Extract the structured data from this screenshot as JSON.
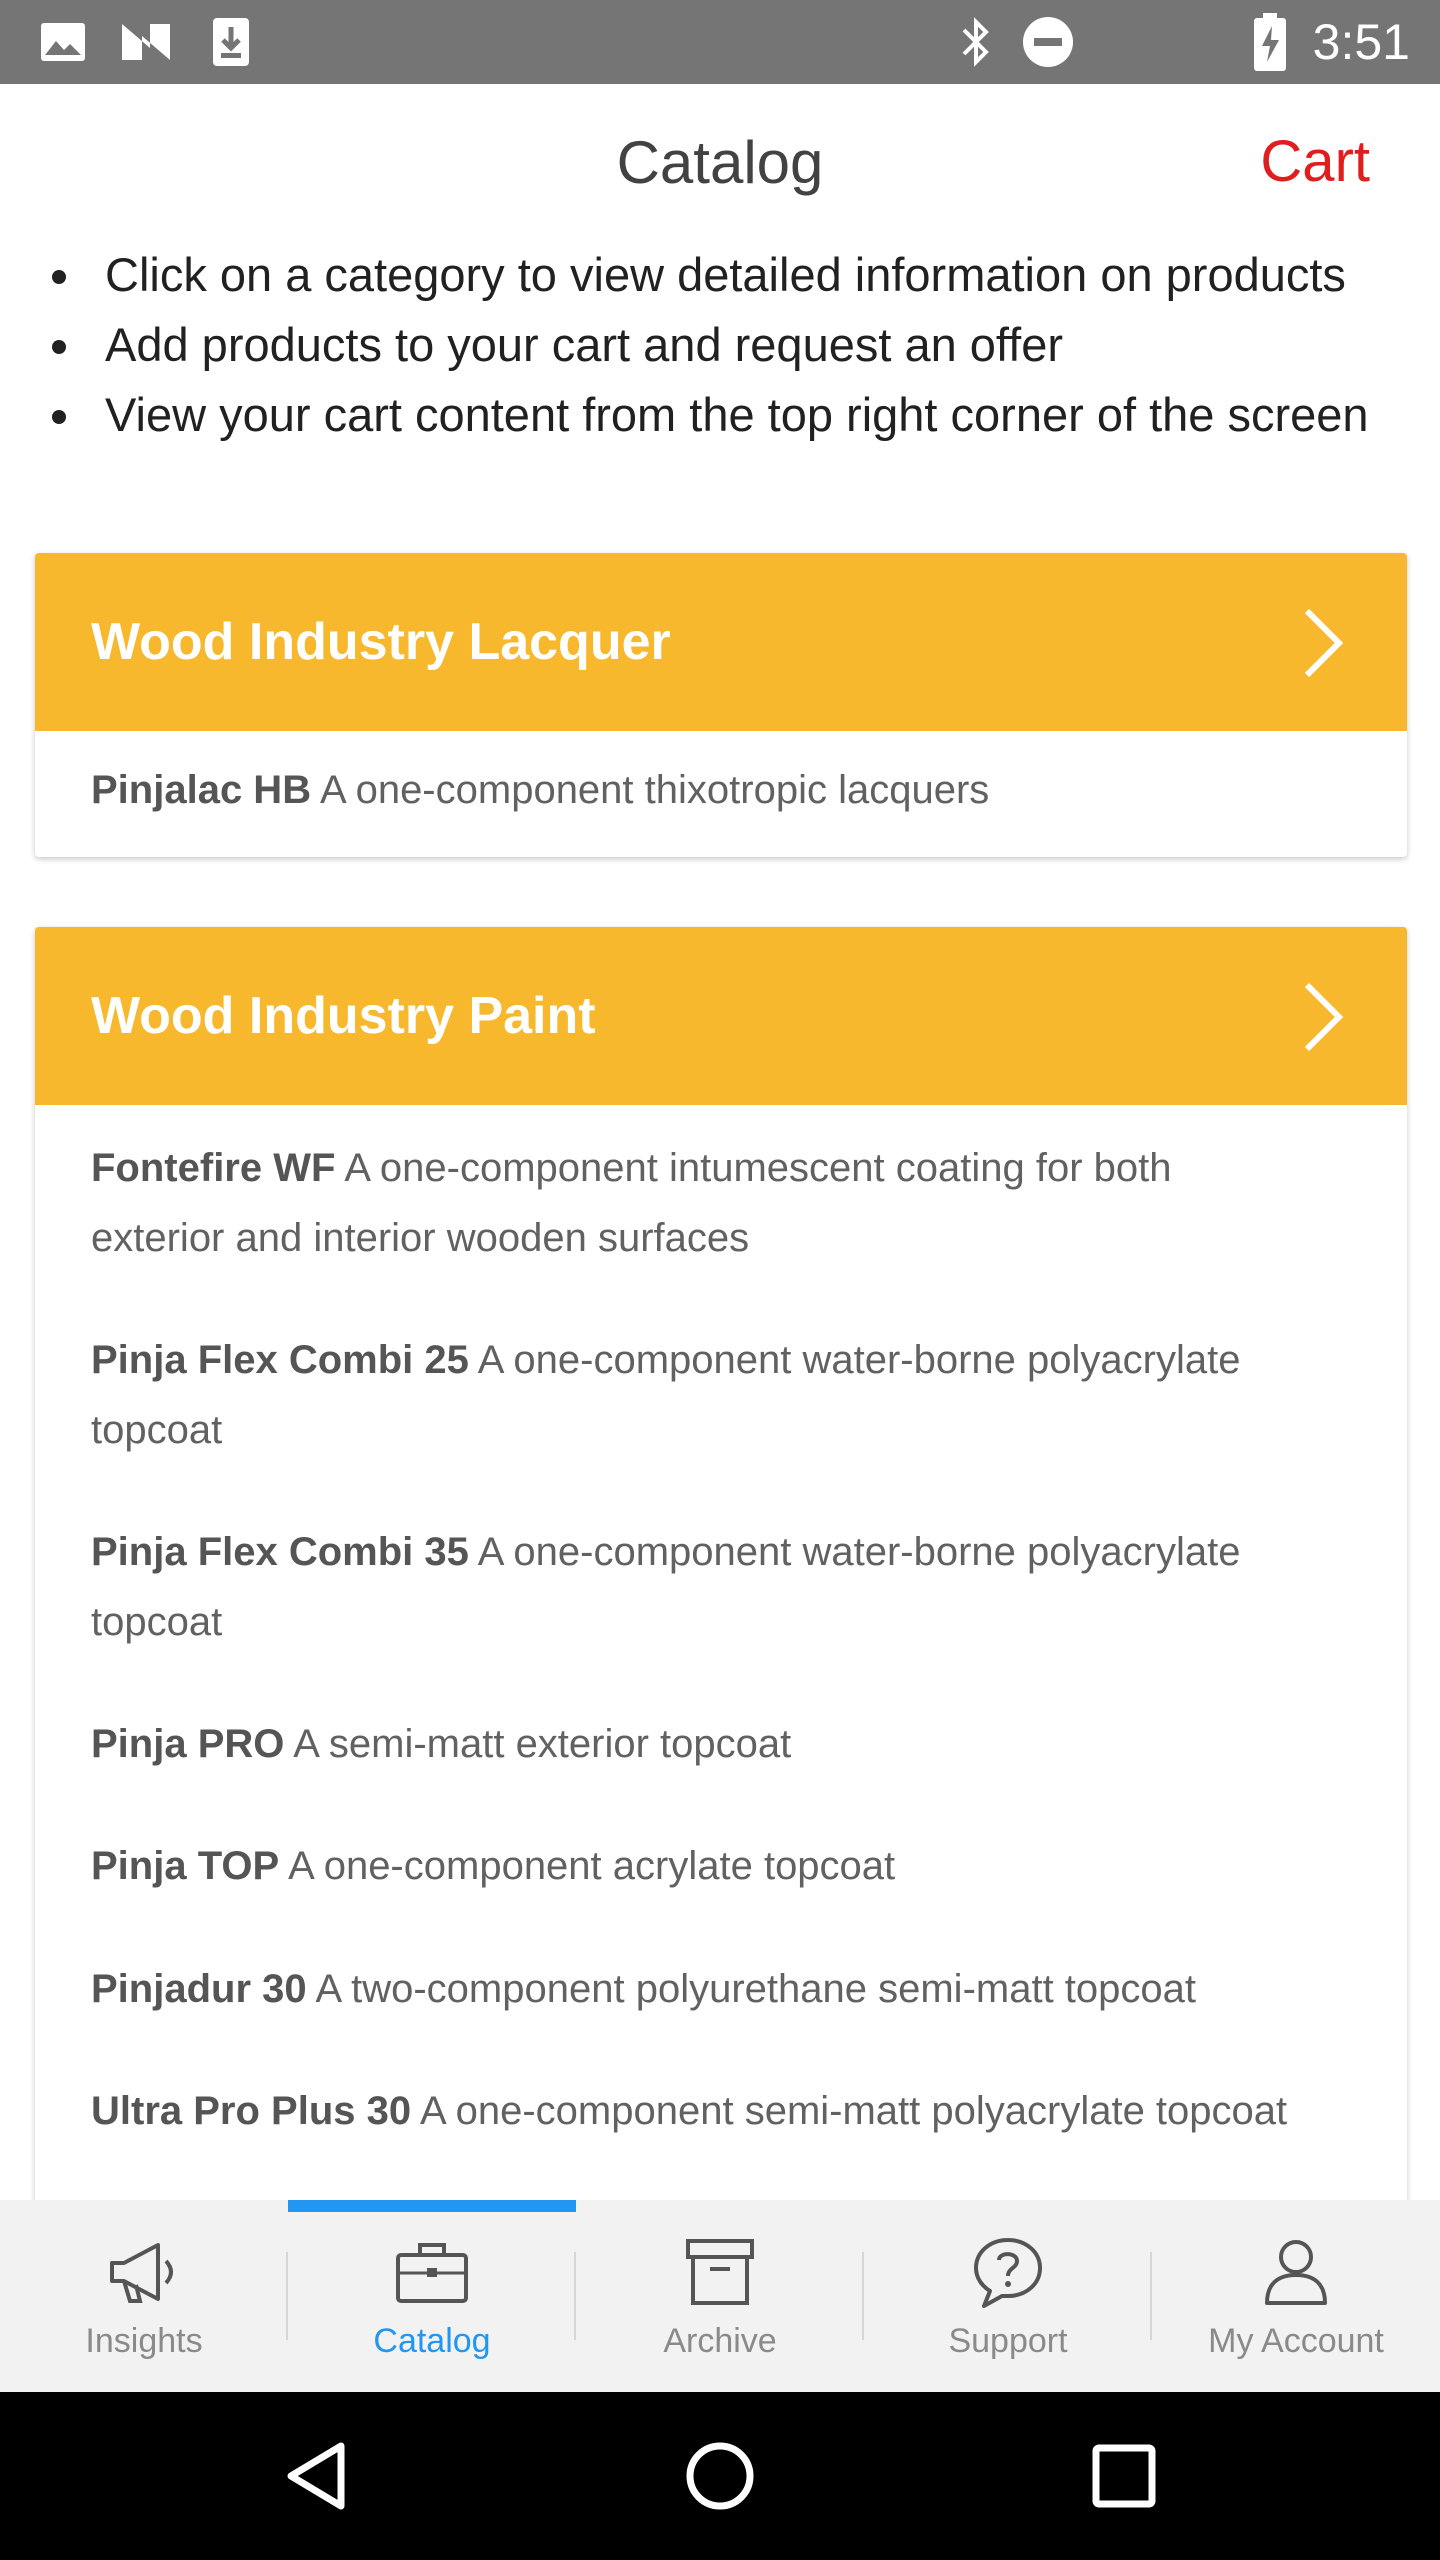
{
  "status_bar": {
    "time": "3:51",
    "left_icons": [
      "image-icon",
      "n-logo-icon",
      "download-icon"
    ],
    "right_icons": [
      "bluetooth-icon",
      "do-not-disturb-icon",
      "battery-charging-icon"
    ]
  },
  "header": {
    "title": "Catalog",
    "cart_label": "Cart",
    "cart_color": "#e01e1e"
  },
  "instructions": [
    "Click on a category to view detailed information on products",
    "Add products to your cart and request an offer",
    "View your cart content from the top right corner of the screen"
  ],
  "categories": [
    {
      "title": "Wood Industry Lacquer",
      "products": [
        {
          "name": "Pinjalac HB",
          "description": "A one-component thixotropic lacquers"
        }
      ]
    },
    {
      "title": "Wood Industry Paint",
      "products": [
        {
          "name": "Fontefire WF",
          "description": "A one-component intumescent coating for both",
          "description_line2": "exterior and interior wooden surfaces"
        },
        {
          "name": "Pinja Flex Combi 25",
          "description": "A one-component water-borne polyacrylate",
          "description_line2": "topcoat"
        },
        {
          "name": "Pinja Flex Combi 35",
          "description": "A one-component water-borne polyacrylate",
          "description_line2": "topcoat"
        },
        {
          "name": "Pinja PRO",
          "description": "A semi-matt exterior topcoat"
        },
        {
          "name": "Pinja TOP",
          "description": "A one-component acrylate topcoat"
        },
        {
          "name": "Pinjadur 30",
          "description": "A two-component polyurethane semi-matt topcoat"
        },
        {
          "name": "Ultra Pro Plus 30",
          "description": "A one-component semi-matt polyacrylate topcoat"
        }
      ]
    }
  ],
  "bottom_nav": [
    {
      "label": "Insights",
      "icon": "megaphone-icon",
      "active": false
    },
    {
      "label": "Catalog",
      "icon": "briefcase-icon",
      "active": true
    },
    {
      "label": "Archive",
      "icon": "archive-box-icon",
      "active": false
    },
    {
      "label": "Support",
      "icon": "question-bubble-icon",
      "active": false
    },
    {
      "label": "My Account",
      "icon": "person-icon",
      "active": false
    }
  ],
  "colors": {
    "accent": "#2196f3",
    "category_header": "#f8b82d",
    "status_bar": "#757575"
  }
}
